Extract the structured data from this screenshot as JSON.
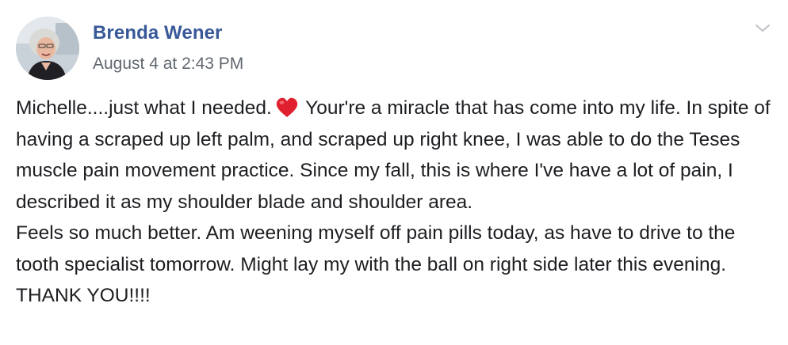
{
  "post": {
    "author": "Brenda Wener",
    "timestamp": "August 4 at 2:43 PM",
    "paragraph1_before_emoji": "Michelle....just what I needed.",
    "emoji": "heart-icon",
    "paragraph1_after_emoji": "Your're a miracle that has come into my life. In spite of having a scraped up left palm, and scraped up right knee, I was able to do the Teses muscle pain movement practice. Since my fall, this is where I've have a lot of pain, I described it as my shoulder blade and shoulder area.",
    "paragraph2": "Feels so much better. Am weening myself off pain pills today, as have to drive to the tooth specialist tomorrow. Might lay my with the ball on right side later this evening. THANK YOU!!!!"
  },
  "colors": {
    "author_link": "#385898",
    "timestamp": "#616770",
    "body_text": "#1c1e21",
    "heart": "#e0202e"
  }
}
